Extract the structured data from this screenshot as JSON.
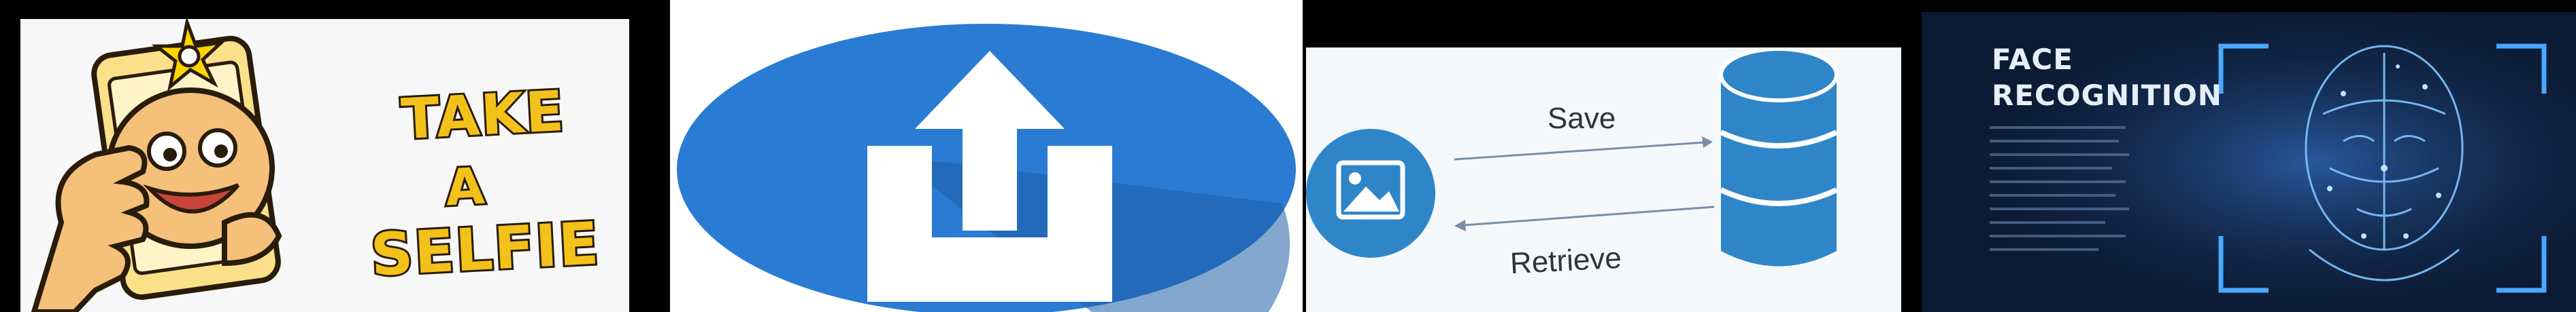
{
  "panels": {
    "selfie": {
      "words": [
        "TAKE",
        "A",
        "SELFIE"
      ],
      "icon": "phone-selfie-hand-icon"
    },
    "upload": {
      "icon": "upload-tray-arrow-icon",
      "colors": {
        "circle": "#2a7bd3",
        "shadow": "#1e5fa6",
        "icon": "#ffffff"
      }
    },
    "save_retrieve": {
      "save_label": "Save",
      "retrieve_label": "Retrieve",
      "icons": [
        "image-icon",
        "database-icon"
      ],
      "colors": {
        "accent": "#2e86c9",
        "arrow": "#7a8ea6"
      }
    },
    "face_recognition": {
      "title_line1": "FACE",
      "title_line2": "RECOGNITION",
      "icon": "wireframe-face-scan-icon",
      "colors": {
        "background": "#0b1a33",
        "glow": "#4aa8ff"
      }
    }
  }
}
